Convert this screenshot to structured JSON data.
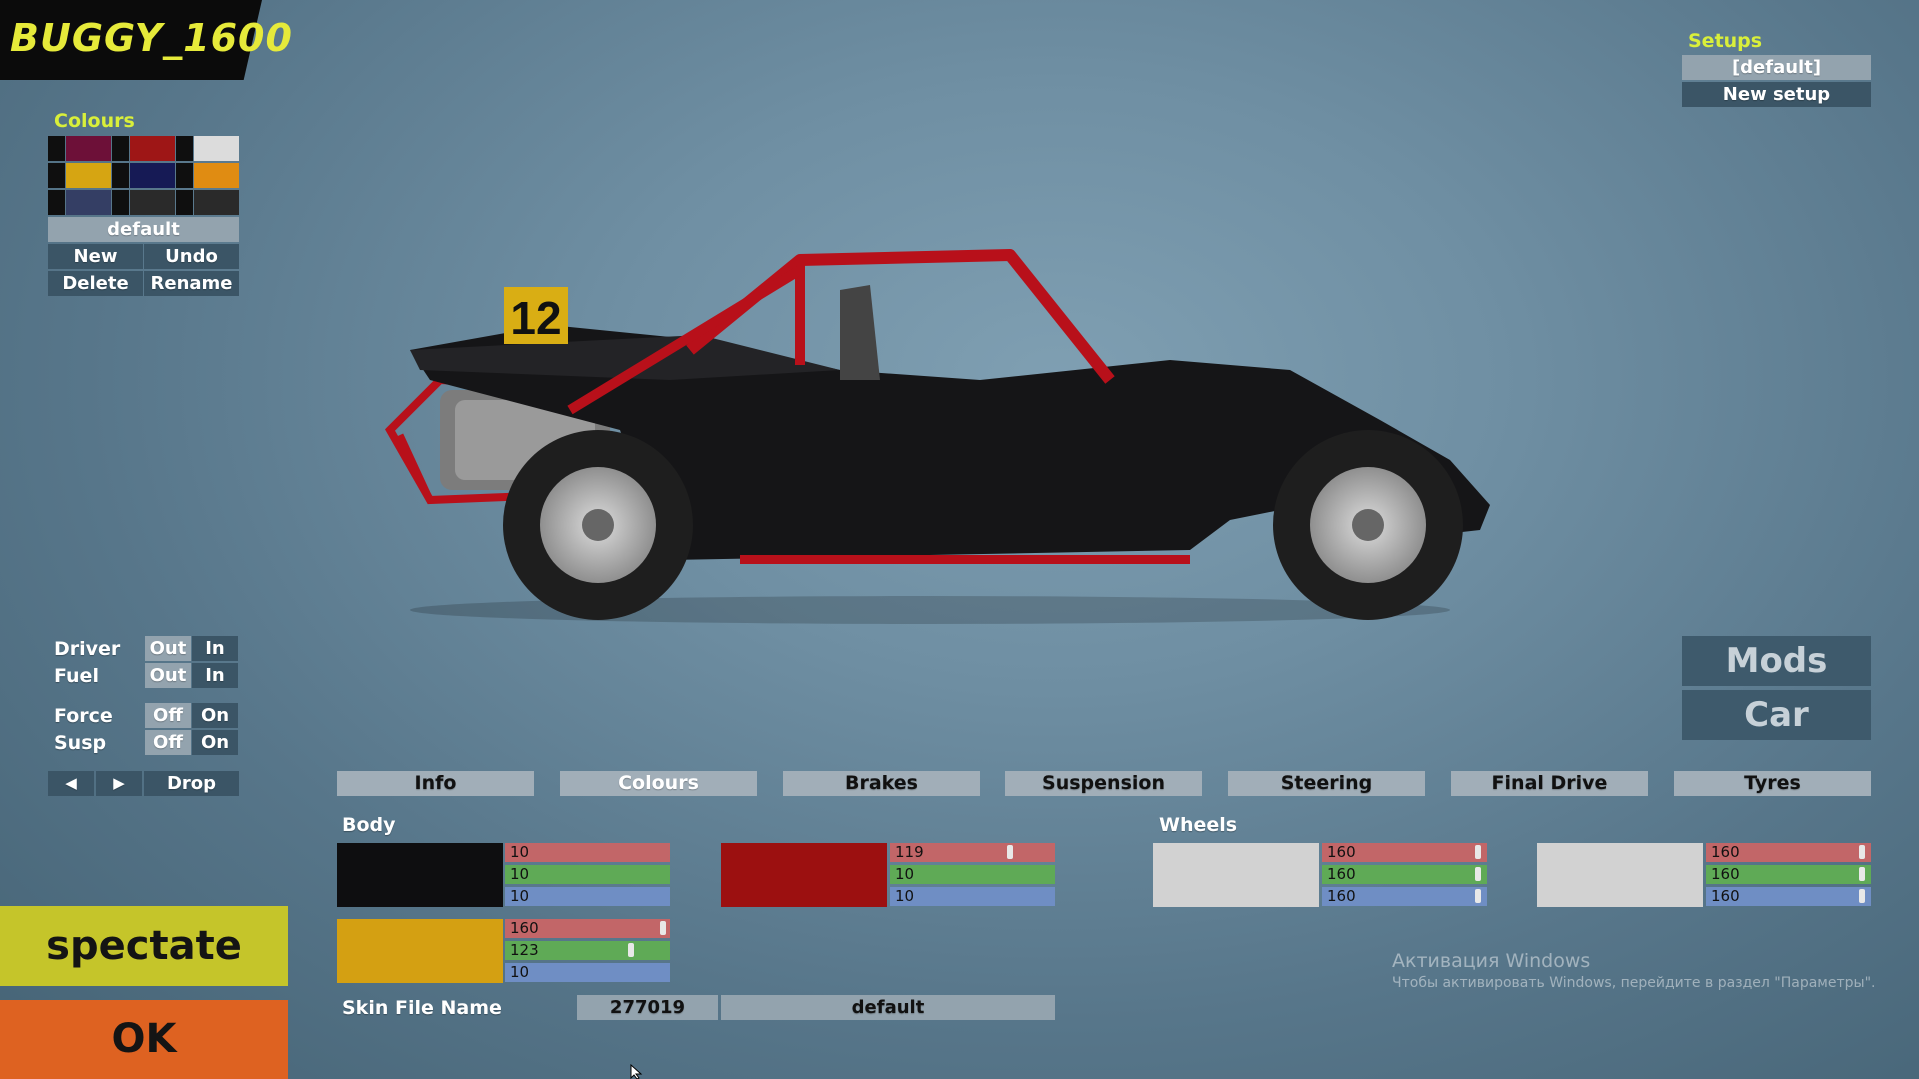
{
  "car_name": "BUGGY_1600",
  "colours_panel": {
    "label": "Colours",
    "preset_name": "default",
    "new_label": "New",
    "undo_label": "Undo",
    "delete_label": "Delete",
    "rename_label": "Rename",
    "swatches": [
      "#6d1038",
      "#9e1616",
      "#dcdcdc",
      "#d6a512",
      "#161a55",
      "#e08c12",
      "#343e64",
      "#2a2a2a",
      "#2a2a2a"
    ]
  },
  "setups": {
    "label": "Setups",
    "items": [
      "[default]",
      "New setup"
    ]
  },
  "options": {
    "driver_label": "Driver",
    "fuel_label": "Fuel",
    "force_label": "Force",
    "susp_label": "Susp",
    "out_label": "Out",
    "in_label": "In",
    "off_label": "Off",
    "on_label": "On",
    "prev_icon": "◀",
    "next_icon": "▶",
    "drop_label": "Drop"
  },
  "mode_buttons": {
    "mods": "Mods",
    "car": "Car"
  },
  "tabs": [
    "Info",
    "Colours",
    "Brakes",
    "Suspension",
    "Steering",
    "Final Drive",
    "Tyres"
  ],
  "body": {
    "label": "Body",
    "colors": [
      {
        "hex": "#0e0e10",
        "r": "10",
        "g": "10",
        "b": "10"
      },
      {
        "hex": "#9c1010",
        "r": "119",
        "g": "10",
        "b": "10"
      },
      {
        "hex": "#d4a012",
        "r": "160",
        "g": "123",
        "b": "10"
      }
    ]
  },
  "wheels": {
    "label": "Wheels",
    "colors": [
      {
        "hex": "#d2d2d2",
        "r": "160",
        "g": "160",
        "b": "160"
      },
      {
        "hex": "#d2d2d2",
        "r": "160",
        "g": "160",
        "b": "160"
      }
    ]
  },
  "skin": {
    "label": "Skin File Name",
    "id": "277019",
    "name": "default"
  },
  "actions": {
    "spectate": "spectate",
    "ok": "OK"
  },
  "car_number": "12",
  "watermark": {
    "title": "Активация Windows",
    "subtitle": "Чтобы активировать Windows, перейдите в раздел \"Параметры\"."
  },
  "colors": {
    "accent_yellow": "#d9ef3a",
    "spectate_bg": "#c5c52a",
    "ok_bg": "#de6221",
    "button_bg": "#93a3ae",
    "tab_bg": "#a1aeb8"
  }
}
